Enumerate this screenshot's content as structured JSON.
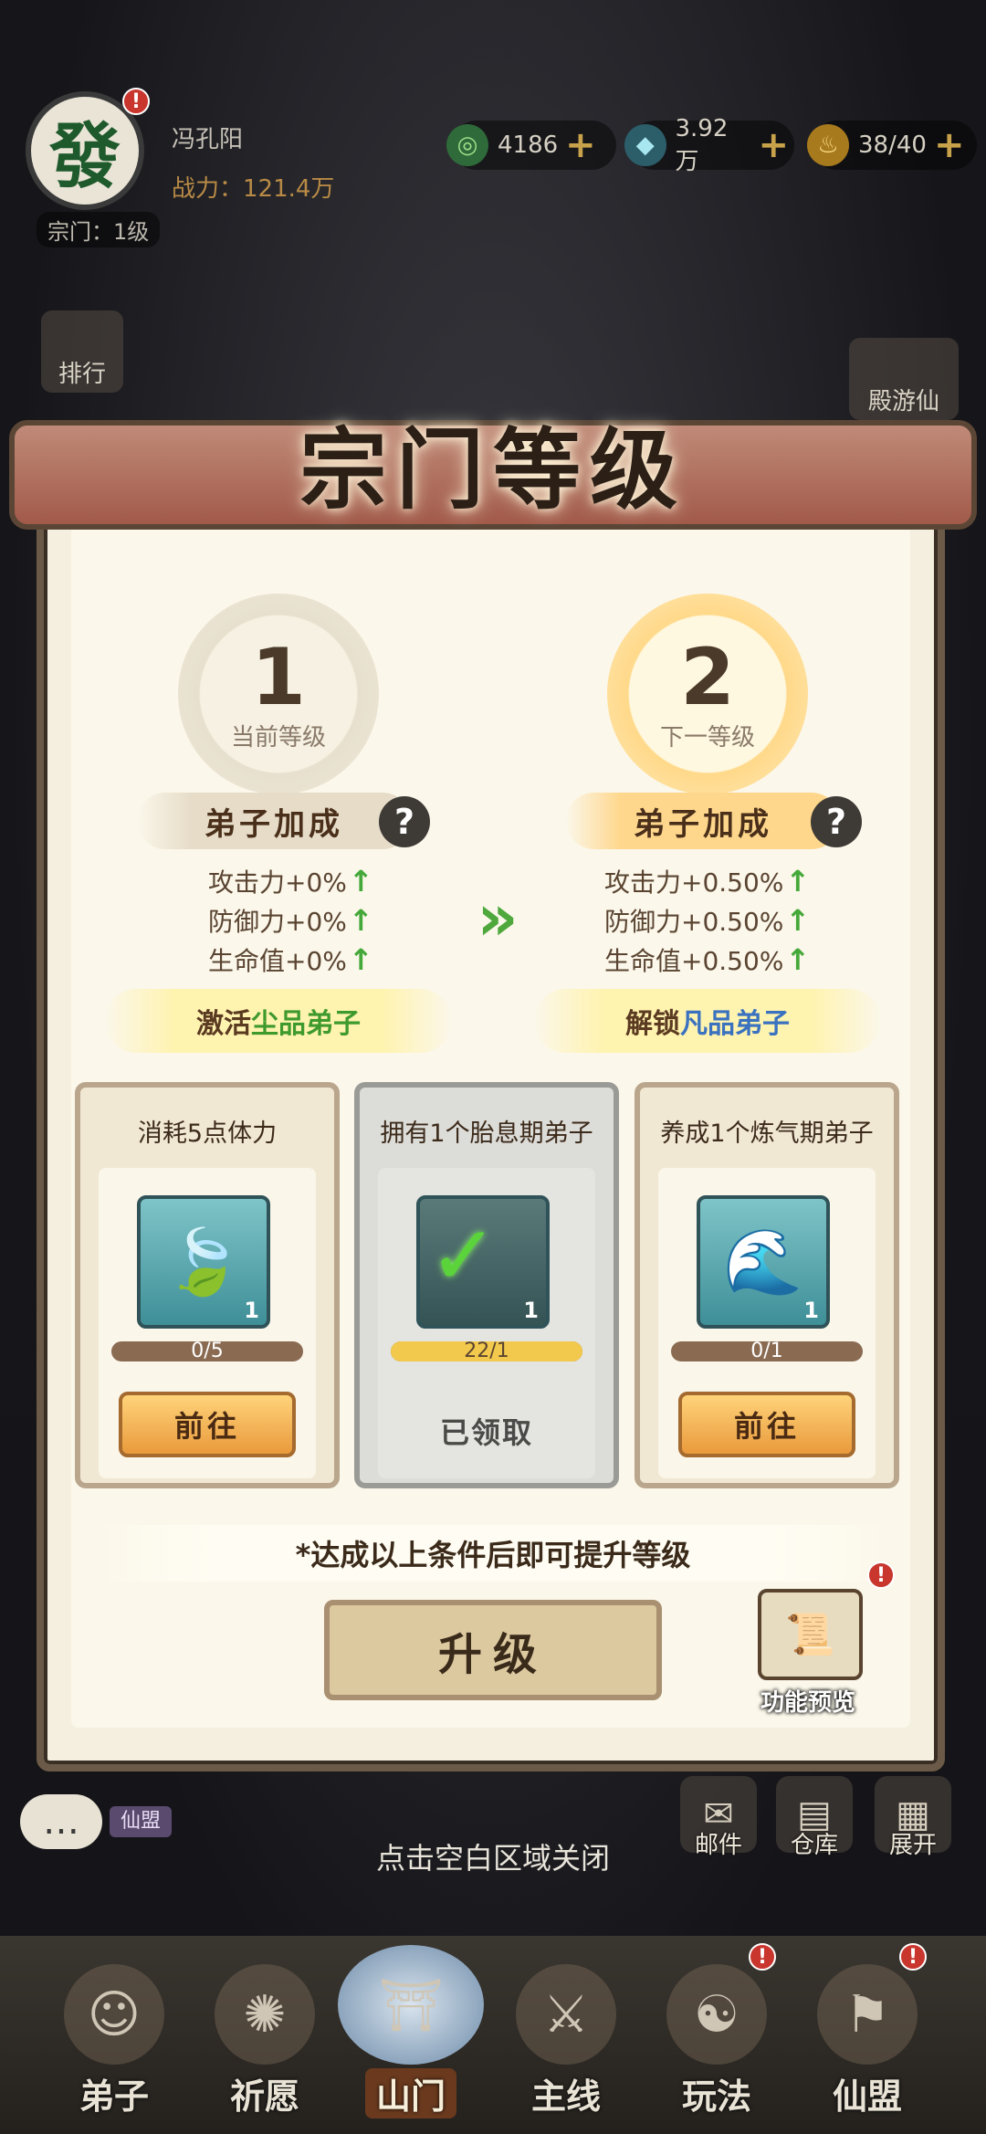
{
  "hud": {
    "avatar_char": "發",
    "player_name": "冯孔阳",
    "power": "战力：121.4万",
    "sect_level": "宗门：1级",
    "resources": [
      {
        "name": "jade-icon",
        "value": "4186"
      },
      {
        "name": "crystal-icon",
        "value": "3.92万"
      },
      {
        "name": "stamina-icon",
        "value": "38/40"
      }
    ],
    "side_left": "排行",
    "side_right": "殿游仙"
  },
  "panel": {
    "title": "宗门等级",
    "current": {
      "level": "1",
      "label": "当前等级"
    },
    "next": {
      "level": "2",
      "label": "下一等级"
    },
    "bonus_label": "弟子加成",
    "current_stats": [
      "攻击力+0%",
      "防御力+0%",
      "生命值+0%"
    ],
    "next_stats": [
      "攻击力+0.50%",
      "防御力+0.50%",
      "生命值+0.50%"
    ],
    "current_unlock": {
      "prefix": "激活",
      "highlight": "尘品弟子"
    },
    "next_unlock": {
      "prefix": "解锁",
      "highlight": "凡品弟子"
    }
  },
  "tasks": [
    {
      "title": "消耗5点体力",
      "count": "1",
      "progress_text": "0/5",
      "progress": 0.0,
      "button": "前往",
      "done": false,
      "icon": "leaf-book-icon"
    },
    {
      "title": "拥有1个胎息期弟子",
      "count": "1",
      "progress_text": "22/1",
      "progress": 1.0,
      "button": "已领取",
      "done": true,
      "icon": "check-book-icon"
    },
    {
      "title": "养成1个炼气期弟子",
      "count": "1",
      "progress_text": "0/1",
      "progress": 0.0,
      "button": "前往",
      "done": false,
      "icon": "wave-book-icon"
    }
  ],
  "hint": "*达成以上条件后即可提升等级",
  "upgrade_label": "升级",
  "preview_label": "功能预览",
  "chat": {
    "channel": "仙盟"
  },
  "close_hint": "点击空白区域关闭",
  "mini_buttons": [
    "邮件",
    "仓库",
    "展开"
  ],
  "nav": [
    "弟子",
    "祈愿",
    "山门",
    "主线",
    "玩法",
    "仙盟"
  ],
  "colors": {
    "accent_gold": "#e99a3c",
    "stat_up": "#45a83a",
    "dust_grade": "#3f9a2e",
    "mortal_grade": "#3a72c0"
  }
}
